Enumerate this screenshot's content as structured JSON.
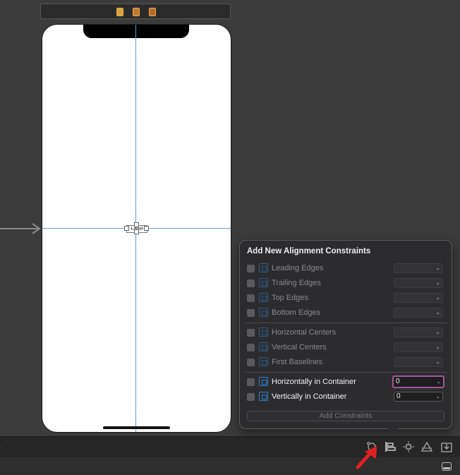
{
  "canvas": {
    "device_label_text": "Label"
  },
  "popover": {
    "title": "Add New Alignment Constraints",
    "rows": [
      {
        "label": "Leading Edges",
        "value": ""
      },
      {
        "label": "Trailing Edges",
        "value": ""
      },
      {
        "label": "Top Edges",
        "value": ""
      },
      {
        "label": "Bottom Edges",
        "value": ""
      },
      {
        "label": "Horizontal Centers",
        "value": ""
      },
      {
        "label": "Vertical Centers",
        "value": ""
      },
      {
        "label": "First Baselines",
        "value": ""
      },
      {
        "label": "Horizontally in Container",
        "value": "0"
      },
      {
        "label": "Vertically in Container",
        "value": "0"
      }
    ],
    "add_button_label": "Add Constraints"
  },
  "toolbar": {
    "icons": [
      "update-frames-icon",
      "align-icon",
      "add-new-constraints-icon",
      "resolve-autolayout-issues-icon",
      "embed-in-icon"
    ]
  },
  "colors": {
    "guide": "#5fa3d8",
    "focus_ring": "#a0569a",
    "annotation_arrow": "#e02020"
  }
}
